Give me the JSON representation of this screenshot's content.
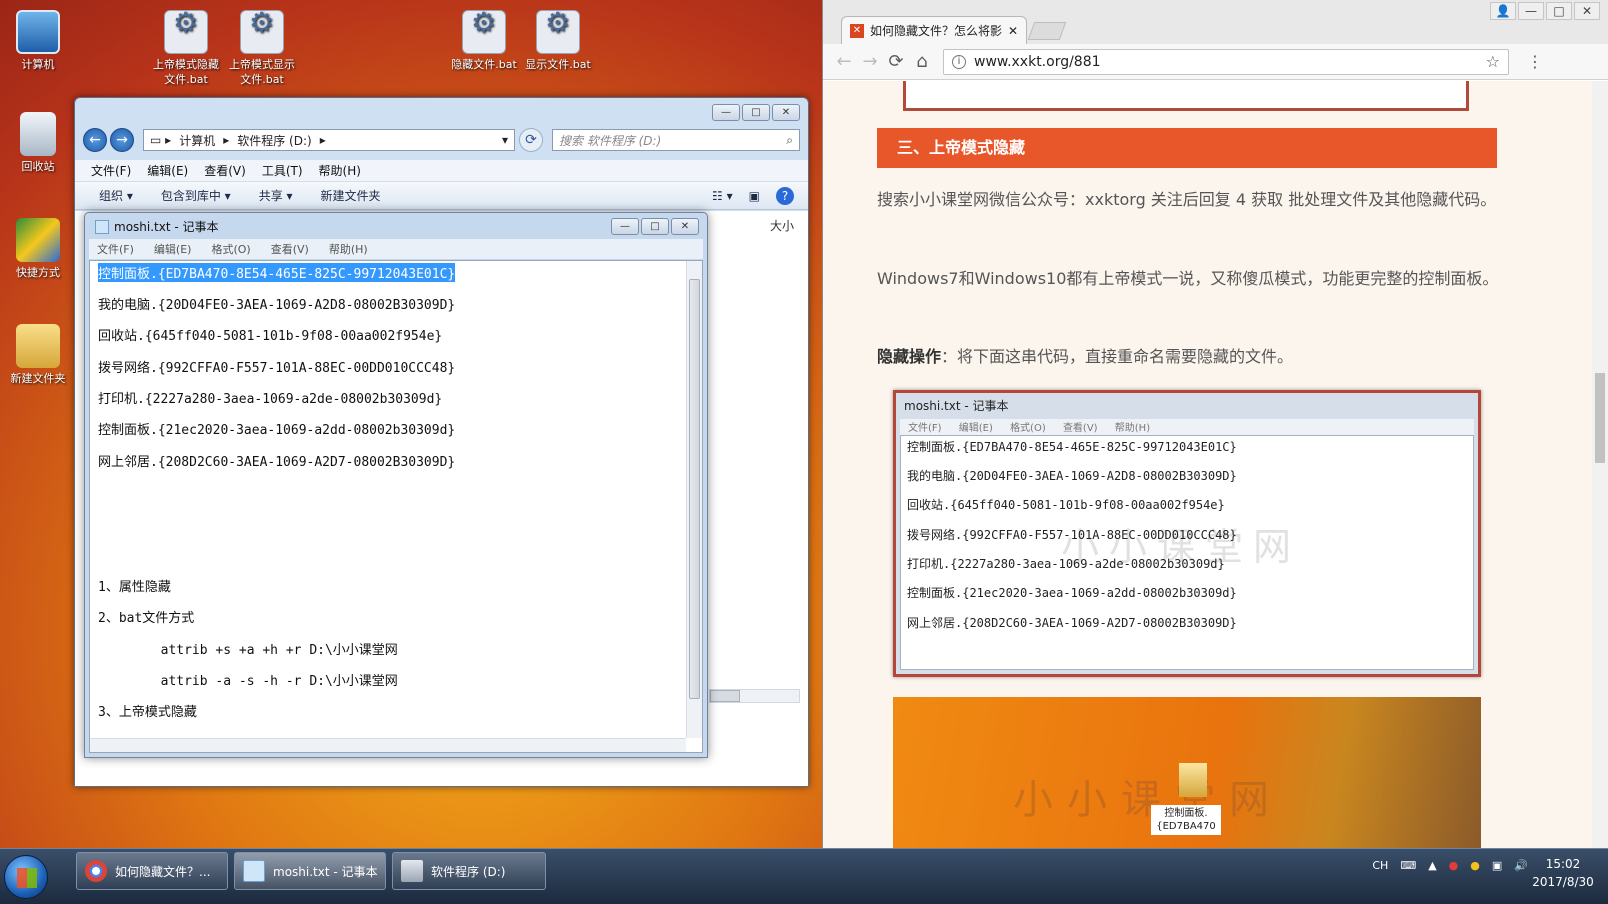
{
  "desktop": {
    "icons": [
      {
        "label": "计算机"
      },
      {
        "label": "回收站"
      },
      {
        "label": "快捷方式"
      },
      {
        "label": "新建文件夹"
      },
      {
        "label": "上帝模式隐藏文件.bat"
      },
      {
        "label": "上帝模式显示文件.bat"
      },
      {
        "label": "隐藏文件.bat"
      },
      {
        "label": "显示文件.bat"
      }
    ]
  },
  "explorer": {
    "breadcrumb": [
      "计算机",
      "软件程序 (D:)"
    ],
    "search_placeholder": "搜索 软件程序 (D:)",
    "menu": [
      "文件(F)",
      "编辑(E)",
      "查看(V)",
      "工具(T)",
      "帮助(H)"
    ],
    "toolbar": [
      "组织 ▾",
      "包含到库中 ▾",
      "共享 ▾",
      "新建文件夹"
    ],
    "column_size": "大小"
  },
  "notepad": {
    "title": "moshi.txt - 记事本",
    "menu": [
      "文件(F)",
      "编辑(E)",
      "格式(O)",
      "查看(V)",
      "帮助(H)"
    ],
    "lines": [
      "控制面板.{ED7BA470-8E54-465E-825C-99712043E01C}",
      "我的电脑.{20D04FE0-3AEA-1069-A2D8-08002B30309D}",
      "回收站.{645ff040-5081-101b-9f08-00aa002f954e}",
      "拨号网络.{992CFFA0-F557-101A-88EC-00DD010CCC48}",
      "打印机.{2227a280-3aea-1069-a2de-08002b30309d}",
      "控制面板.{21ec2020-3aea-1069-a2dd-08002b30309d}",
      "网上邻居.{208D2C60-3AEA-1069-A2D7-08002B30309D}",
      "1、属性隐藏",
      "2、bat文件方式",
      "        attrib +s +a +h +r D:\\小小课堂网",
      "        attrib -a -s -h -r D:\\小小课堂网",
      "3、上帝模式隐藏"
    ]
  },
  "browser": {
    "tab_title": "如何隐藏文件？怎么将影",
    "url": "www.xxkt.org/881",
    "section_title": "三、上帝模式隐藏",
    "para1": "搜索小小课堂网微信公众号：xxktorg  关注后回复 4 获取 批处理文件及其他隐藏代码。",
    "para2": "Windows7和Windows10都有上帝模式一说，又称傻瓜模式，功能更完整的控制面板。",
    "para3_bold": "隐藏操作",
    "para3_rest": "：将下面这串代码，直接重命名需要隐藏的文件。",
    "shot_title": "moshi.txt - 记事本",
    "shot_menu": [
      "文件(F)",
      "编辑(E)",
      "格式(O)",
      "查看(V)",
      "帮助(H)"
    ],
    "shot_lines": [
      "控制面板.{ED7BA470-8E54-465E-825C-99712043E01C}",
      "我的电脑.{20D04FE0-3AEA-1069-A2D8-08002B30309D}",
      "回收站.{645ff040-5081-101b-9f08-00aa002f954e}",
      "拨号网络.{992CFFA0-F557-101A-88EC-00DD010CCC48}",
      "打印机.{2227a280-3aea-1069-a2de-08002b30309d}",
      "控制面板.{21ec2020-3aea-1069-a2dd-08002b30309d}",
      "网上邻居.{208D2C60-3AEA-1069-A2D7-08002B30309D}"
    ],
    "watermark": "小小课堂网",
    "photo_label": "控制面板.{ED7BA470"
  },
  "taskbar": {
    "items": [
      "如何隐藏文件？...",
      "moshi.txt - 记事本",
      "软件程序 (D:)"
    ],
    "tray_lang": "CH",
    "time": "15:02",
    "date": "2017/8/30"
  },
  "colors": {
    "accent_section": "#e8572a",
    "selection": "#3399ff"
  }
}
